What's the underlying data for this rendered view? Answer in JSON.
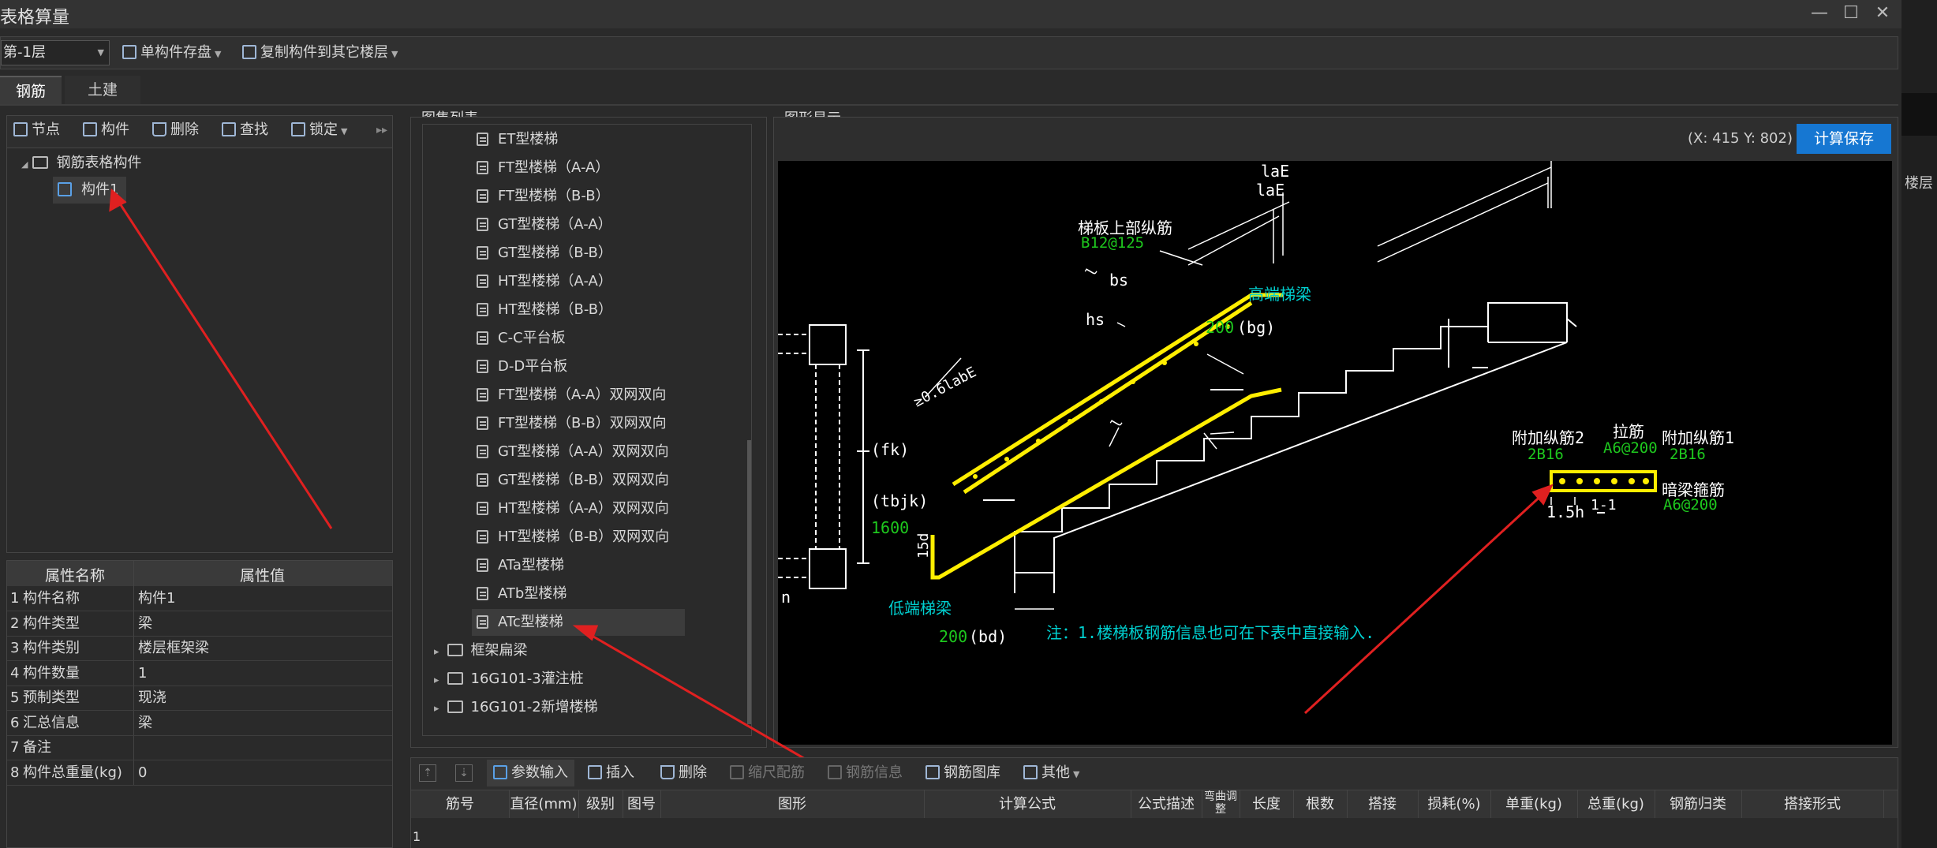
{
  "window": {
    "title": "表格算量",
    "buttons": [
      "—",
      "☐",
      "✕"
    ]
  },
  "toolbar": {
    "floor": "第-1层",
    "save_single": "单构件存盘",
    "copy_to_floor": "复制构件到其它楼层"
  },
  "tabs": [
    "钢筋",
    "土建"
  ],
  "left_tools": [
    "节点",
    "构件",
    "删除",
    "查找",
    "锁定"
  ],
  "tree": {
    "root": "钢筋表格构件",
    "child": "构件1"
  },
  "props": {
    "headers": [
      "属性名称",
      "属性值"
    ],
    "rows": [
      {
        "no": "1",
        "name": "构件名称",
        "value": "构件1"
      },
      {
        "no": "2",
        "name": "构件类型",
        "value": "梁"
      },
      {
        "no": "3",
        "name": "构件类别",
        "value": "楼层框架梁"
      },
      {
        "no": "4",
        "name": "构件数量",
        "value": "1"
      },
      {
        "no": "5",
        "name": "预制类型",
        "value": "现浇"
      },
      {
        "no": "6",
        "name": "汇总信息",
        "value": "梁"
      },
      {
        "no": "7",
        "name": "备注",
        "value": ""
      },
      {
        "no": "8",
        "name": "构件总重量(kg)",
        "value": "0"
      }
    ]
  },
  "atlas": {
    "title": "图集列表",
    "items": [
      "ET型楼梯",
      "FT型楼梯（A-A）",
      "FT型楼梯（B-B）",
      "GT型楼梯（A-A）",
      "GT型楼梯（B-B）",
      "HT型楼梯（A-A）",
      "HT型楼梯（B-B）",
      "C-C平台板",
      "D-D平台板",
      "FT型楼梯（A-A）双网双向",
      "FT型楼梯（B-B）双网双向",
      "GT型楼梯（A-A）双网双向",
      "GT型楼梯（B-B）双网双向",
      "HT型楼梯（A-A）双网双向",
      "HT型楼梯（B-B）双网双向",
      "ATa型楼梯",
      "ATb型楼梯",
      "ATc型楼梯"
    ],
    "folders": [
      "框架扁梁",
      "16G101-3灌注桩",
      "16G101-2新增楼梯"
    ]
  },
  "graphic": {
    "title": "图形显示",
    "coords": "(X: 415 Y: 802)",
    "calc_save": "计算保存",
    "labels": {
      "lae1": "laE",
      "lae2": "laE",
      "top_bar": "梯板上部纵筋",
      "top_bar_spec": "B12@125",
      "bs": "bs",
      "hs": "hs",
      "l1": "l",
      "l2": "l",
      "high_beam": "高端梯梁",
      "bg_val": "200",
      "bg": "(bg)",
      "fk": "(fk)",
      "tbjk": "(tbjk)",
      "tbjk_val": "1600",
      "lab": "≥0.6labE",
      "d15": "15d",
      "low_beam": "低端梯梁",
      "bd_val": "200",
      "bd": "(bd)",
      "n": "n",
      "add2": "附加纵筋2",
      "add2_spec": "2B16",
      "tie": "拉筋",
      "tie_spec": "A6@200",
      "add1": "附加纵筋1",
      "add1_spec": "2B16",
      "hidden": "暗梁箍筋",
      "hidden_spec": "A6@200",
      "h15": "1.5h",
      "sec": "1-1",
      "note": "注：1.楼梯板钢筋信息也可在下表中直接输入."
    },
    "colors": {
      "green": "#1ec81e",
      "cyan": "#00d0d0",
      "yellow": "#ffee00",
      "white": "#ffffff"
    }
  },
  "bottom_tools": [
    "参数输入",
    "插入",
    "删除",
    "缩尺配筋",
    "钢筋信息",
    "钢筋图库",
    "其他"
  ],
  "grid_headers": [
    "筋号",
    "直径(mm)",
    "级别",
    "图号",
    "图形",
    "计算公式",
    "公式描述",
    "弯曲调整",
    "长度",
    "根数",
    "搭接",
    "损耗(%)",
    "单重(kg)",
    "总重(kg)",
    "钢筋归类",
    "搭接形式"
  ],
  "grid_first_row": "1",
  "right_edge": {
    "close": "×",
    "floor": "楼层"
  }
}
